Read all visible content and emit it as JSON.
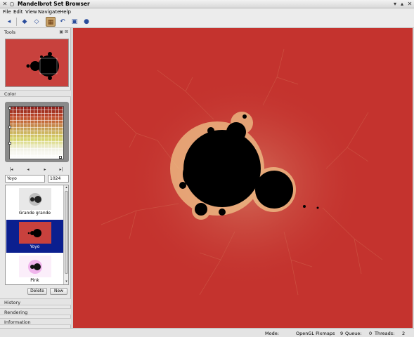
{
  "window": {
    "title": "Mandelbrot Set Browser",
    "icons": [
      "x-logo-icon",
      "circle-icon"
    ],
    "controls": [
      "minimize-icon",
      "maximize-icon",
      "close-icon"
    ]
  },
  "menubar": {
    "items": [
      "File",
      "Edit",
      "View",
      "Navigate",
      "Help"
    ]
  },
  "toolbar": {
    "buttons": [
      "back-icon",
      "prev-icon",
      "forward-icon",
      "select-mode-icon",
      "undo-icon",
      "snapshot-icon",
      "info-icon"
    ]
  },
  "sidebar": {
    "tools_label": "Tools",
    "tools_controls": "▣ ⊠",
    "color_label": "Color",
    "nav_buttons": [
      "|◂",
      "◂",
      "▸",
      "▸|"
    ],
    "palette_name": "Yoyo",
    "palette_size": "1024",
    "presets": [
      {
        "label": "Grande grande",
        "selected": false
      },
      {
        "label": "Yoyo",
        "selected": true
      },
      {
        "label": "Pink",
        "selected": false
      }
    ],
    "delete_label": "Delete",
    "new_label": "New",
    "sections": [
      "History",
      "Rendering",
      "Information"
    ]
  },
  "statusbar": {
    "mode_label": "Mode:",
    "mode_value": "OpenGL Pixmaps",
    "queue_label": "Queue:",
    "queue_value": "9",
    "queue_extra": "0",
    "threads_label": "Threads:",
    "threads_value": "2"
  },
  "colors": {
    "fractal_bg": "#c4332e",
    "fractal_set": "#000000",
    "selection": "#0b1f8f"
  }
}
